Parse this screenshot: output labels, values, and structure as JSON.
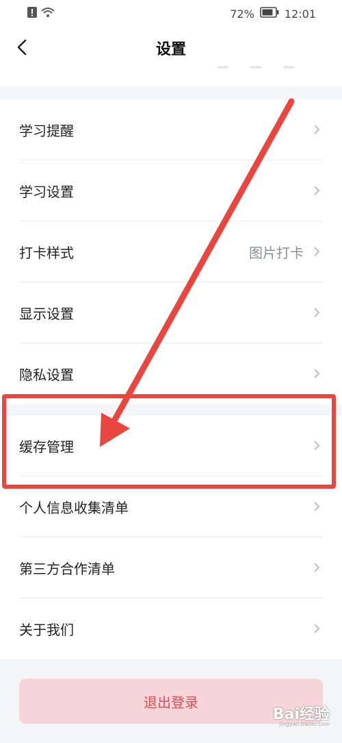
{
  "status_bar": {
    "battery": "72%",
    "time": "12:01"
  },
  "nav": {
    "title": "设置"
  },
  "settings": {
    "group1": [
      {
        "label": "学习提醒",
        "value": ""
      },
      {
        "label": "学习设置",
        "value": ""
      },
      {
        "label": "打卡样式",
        "value": "图片打卡"
      },
      {
        "label": "显示设置",
        "value": ""
      },
      {
        "label": "隐私设置",
        "value": ""
      }
    ],
    "group2": [
      {
        "label": "缓存管理"
      },
      {
        "label": "个人信息收集清单"
      },
      {
        "label": "第三方合作清单"
      },
      {
        "label": "关于我们"
      }
    ]
  },
  "logout": {
    "label": "退出登录"
  },
  "watermark": {
    "text": "Bai经验",
    "sub": "jingyan.baidu.com"
  },
  "colors": {
    "annotation": "#e8473f",
    "logout_bg": "#f6d5d8",
    "logout_text": "#d94f58"
  }
}
